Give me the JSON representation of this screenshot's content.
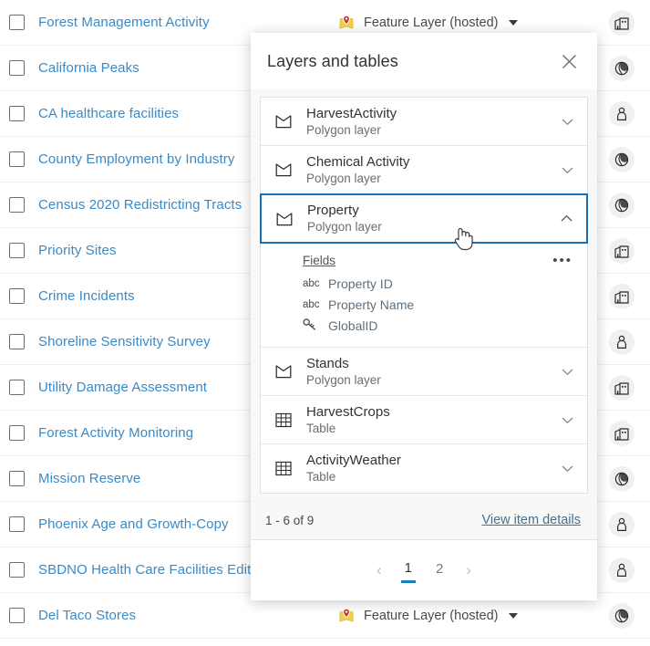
{
  "item_list": {
    "type_label": "Feature Layer (hosted)",
    "rows": [
      {
        "title": "Forest Management Activity",
        "show_type": true,
        "avatar_icon": "building-icon"
      },
      {
        "title": "California Peaks",
        "show_type": false,
        "avatar_icon": "globe-icon"
      },
      {
        "title": "CA healthcare facilities",
        "show_type": false,
        "avatar_icon": "person-icon"
      },
      {
        "title": "County Employment by Industry",
        "show_type": false,
        "avatar_icon": "globe-icon"
      },
      {
        "title": "Census 2020 Redistricting Tracts",
        "show_type": false,
        "avatar_icon": "globe-icon"
      },
      {
        "title": "Priority Sites",
        "show_type": false,
        "avatar_icon": "building-icon"
      },
      {
        "title": "Crime Incidents",
        "show_type": false,
        "avatar_icon": "building-icon"
      },
      {
        "title": "Shoreline Sensitivity Survey",
        "show_type": false,
        "avatar_icon": "person-icon"
      },
      {
        "title": "Utility Damage Assessment",
        "show_type": false,
        "avatar_icon": "building-icon"
      },
      {
        "title": "Forest Activity Monitoring",
        "show_type": false,
        "avatar_icon": "building-icon"
      },
      {
        "title": "Mission Reserve",
        "show_type": false,
        "avatar_icon": "globe-icon"
      },
      {
        "title": "Phoenix Age and Growth-Copy",
        "show_type": false,
        "avatar_icon": "person-icon"
      },
      {
        "title": "SBDNO Health Care Facilities Edit",
        "show_type": false,
        "avatar_icon": "person-icon"
      },
      {
        "title": "Del Taco Stores",
        "show_type": true,
        "avatar_icon": "globe-icon"
      }
    ]
  },
  "modal": {
    "title": "Layers and tables",
    "close_label": "Close",
    "layers": [
      {
        "name": "HarvestActivity",
        "sub": "Polygon layer",
        "icon": "polygon-layer-icon",
        "expanded": false,
        "selected": false
      },
      {
        "name": "Chemical Activity",
        "sub": "Polygon layer",
        "icon": "polygon-layer-icon",
        "expanded": false,
        "selected": false
      },
      {
        "name": "Property",
        "sub": "Polygon layer",
        "icon": "polygon-layer-icon",
        "expanded": true,
        "selected": true
      },
      {
        "name": "Stands",
        "sub": "Polygon layer",
        "icon": "polygon-layer-icon",
        "expanded": false,
        "selected": false
      },
      {
        "name": "HarvestCrops",
        "sub": "Table",
        "icon": "table-icon",
        "expanded": false,
        "selected": false
      },
      {
        "name": "ActivityWeather",
        "sub": "Table",
        "icon": "table-icon",
        "expanded": false,
        "selected": false
      }
    ],
    "fields_panel": {
      "heading": "Fields",
      "overflow_label": "•••",
      "fields": [
        {
          "type": "abc",
          "type_icon": "text-field-icon",
          "label": "Property ID"
        },
        {
          "type": "abc",
          "type_icon": "text-field-icon",
          "label": "Property Name"
        },
        {
          "type": "",
          "type_icon": "key-field-icon",
          "label": "GlobalID"
        }
      ]
    },
    "footer": {
      "count": "1 - 6 of 9",
      "details_link": "View item details",
      "pagination": {
        "prev": "‹",
        "next": "›",
        "pages": [
          "1",
          "2"
        ],
        "active": "1"
      }
    }
  },
  "colors": {
    "link_blue": "#3a8ac6",
    "selection_blue": "#1a6eb5",
    "active_page_underline": "#1a7fc1",
    "map_tag_yellow": "#f2d24b",
    "map_pin_red": "#d03030"
  }
}
